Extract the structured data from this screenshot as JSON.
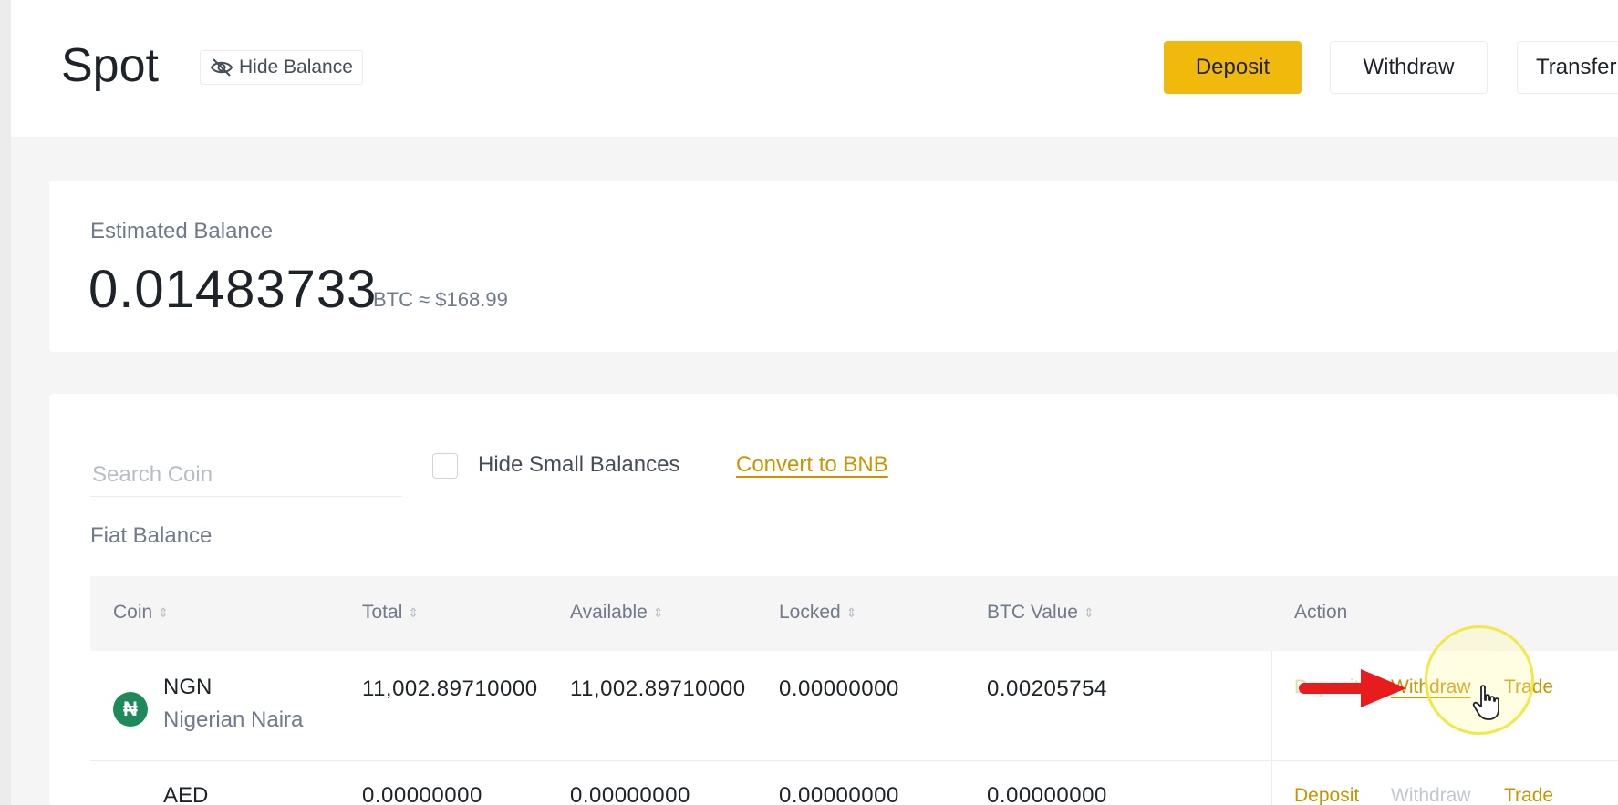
{
  "header": {
    "title": "Spot",
    "hide_balance_label": "Hide Balance",
    "deposit_label": "Deposit",
    "withdraw_label": "Withdraw",
    "transfer_label": "Transfer"
  },
  "balance": {
    "label": "Estimated Balance",
    "value": "0.01483733",
    "sub": "BTC ≈ $168.99"
  },
  "filters": {
    "search_placeholder": "Search Coin",
    "hide_small_label": "Hide Small Balances",
    "hide_small_checked": false,
    "convert_label": "Convert to BNB"
  },
  "section": {
    "fiat_label": "Fiat Balance"
  },
  "table": {
    "columns": [
      "Coin",
      "Total",
      "Available",
      "Locked",
      "BTC Value",
      "Action"
    ],
    "rows": [
      {
        "icon_glyph": "₦",
        "symbol": "NGN",
        "name": "Nigerian Naira",
        "total": "11,002.89710000",
        "available": "11,002.89710000",
        "locked": "0.00000000",
        "btc_value": "0.00205754",
        "actions": [
          "Deposit",
          "Withdraw",
          "Trade"
        ]
      },
      {
        "symbol": "AED",
        "total": "0.00000000",
        "available": "0.00000000",
        "locked": "0.00000000",
        "btc_value": "0.00000000",
        "actions": [
          "Deposit",
          "Withdraw",
          "Trade"
        ]
      }
    ]
  },
  "colors": {
    "accent": "#f0b90b",
    "link": "#c99400",
    "annotation_arrow": "#e81c1c",
    "annotation_circle": "#f0e63c"
  }
}
